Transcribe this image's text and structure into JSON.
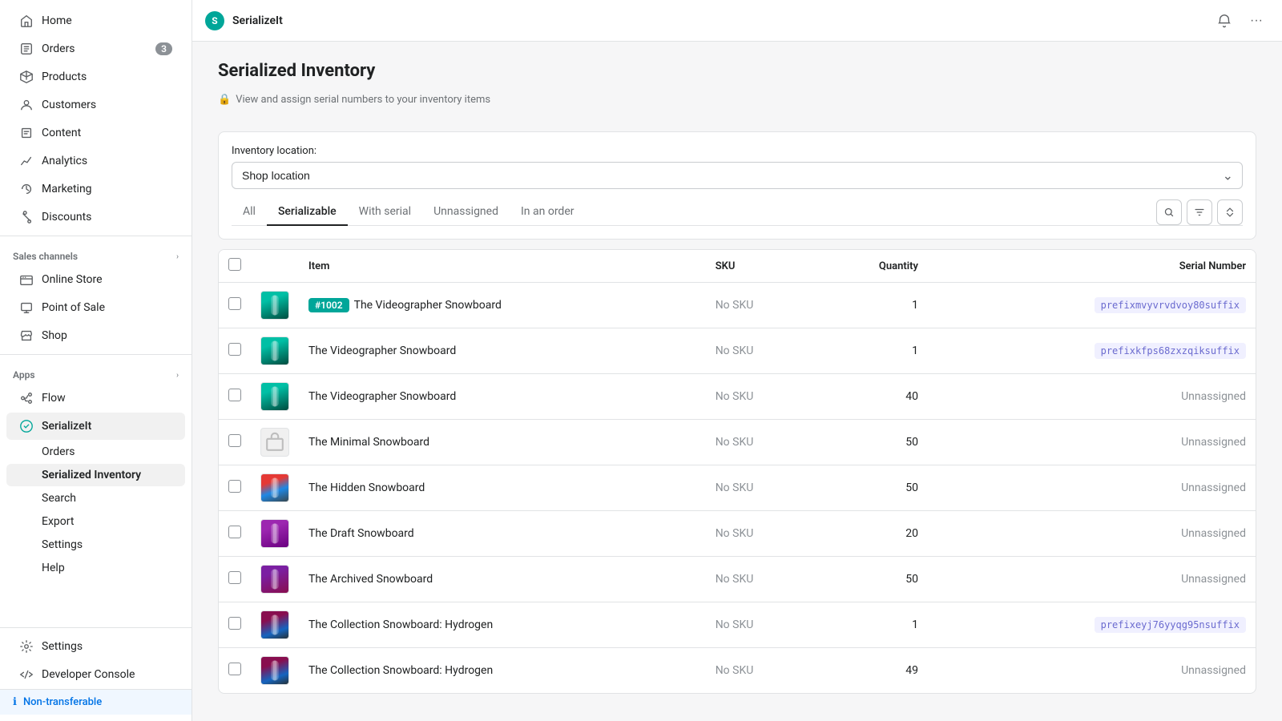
{
  "topbar": {
    "logo_text": "S",
    "title": "SerializeIt",
    "logo_bg": "#00a699"
  },
  "sidebar": {
    "nav_items": [
      {
        "id": "home",
        "label": "Home",
        "icon": "home"
      },
      {
        "id": "orders",
        "label": "Orders",
        "icon": "orders",
        "badge": "3"
      },
      {
        "id": "products",
        "label": "Products",
        "icon": "products"
      },
      {
        "id": "customers",
        "label": "Customers",
        "icon": "customers"
      },
      {
        "id": "content",
        "label": "Content",
        "icon": "content"
      },
      {
        "id": "analytics",
        "label": "Analytics",
        "icon": "analytics"
      },
      {
        "id": "marketing",
        "label": "Marketing",
        "icon": "marketing"
      },
      {
        "id": "discounts",
        "label": "Discounts",
        "icon": "discounts"
      }
    ],
    "sales_channels": {
      "label": "Sales channels",
      "items": [
        {
          "id": "online-store",
          "label": "Online Store"
        },
        {
          "id": "point-of-sale",
          "label": "Point of Sale"
        },
        {
          "id": "shop",
          "label": "Shop"
        }
      ]
    },
    "apps": {
      "label": "Apps",
      "items": [
        {
          "id": "flow",
          "label": "Flow"
        },
        {
          "id": "serializeit",
          "label": "SerializeIt",
          "active": true,
          "sub_items": [
            {
              "id": "orders",
              "label": "Orders"
            },
            {
              "id": "serialized-inventory",
              "label": "Serialized Inventory",
              "active": true
            },
            {
              "id": "search",
              "label": "Search"
            },
            {
              "id": "export",
              "label": "Export"
            },
            {
              "id": "settings",
              "label": "Settings"
            },
            {
              "id": "help",
              "label": "Help"
            }
          ]
        }
      ]
    },
    "bottom_items": [
      {
        "id": "settings",
        "label": "Settings",
        "icon": "gear"
      },
      {
        "id": "developer-console",
        "label": "Developer Console",
        "icon": "developer"
      }
    ]
  },
  "page": {
    "title": "Serialized Inventory",
    "subtitle": "View and assign serial numbers to your inventory items",
    "inventory_location_label": "Inventory location:",
    "location_value": "Shop location",
    "tabs": [
      {
        "id": "all",
        "label": "All"
      },
      {
        "id": "serializable",
        "label": "Serializable",
        "active": true
      },
      {
        "id": "with-serial",
        "label": "With serial"
      },
      {
        "id": "unnassigned",
        "label": "Unnassigned"
      },
      {
        "id": "in-an-order",
        "label": "In an order"
      }
    ],
    "table": {
      "columns": [
        {
          "id": "item",
          "label": "Item"
        },
        {
          "id": "sku",
          "label": "SKU"
        },
        {
          "id": "quantity",
          "label": "Quantity",
          "align": "right"
        },
        {
          "id": "serial",
          "label": "Serial Number",
          "align": "right"
        }
      ],
      "rows": [
        {
          "id": "row1",
          "badge": "#1002",
          "item": "The Videographer Snowboard",
          "sku": "No SKU",
          "quantity": "1",
          "serial": "prefixmvyvrvdvoy80suffix",
          "serial_type": "badge",
          "img_type": "teal"
        },
        {
          "id": "row2",
          "item": "The Videographer Snowboard",
          "sku": "No SKU",
          "quantity": "1",
          "serial": "prefixkfps68zxzqiksuffix",
          "serial_type": "badge",
          "img_type": "teal"
        },
        {
          "id": "row3",
          "item": "The Videographer Snowboard",
          "sku": "No SKU",
          "quantity": "40",
          "serial": "Unnassigned",
          "serial_type": "plain",
          "img_type": "teal"
        },
        {
          "id": "row4",
          "item": "The Minimal Snowboard",
          "sku": "No SKU",
          "quantity": "50",
          "serial": "Unnassigned",
          "serial_type": "plain",
          "img_type": "box"
        },
        {
          "id": "row5",
          "item": "The Hidden Snowboard",
          "sku": "No SKU",
          "quantity": "50",
          "serial": "Unnassigned",
          "serial_type": "plain",
          "img_type": "mixed"
        },
        {
          "id": "row6",
          "item": "The Draft Snowboard",
          "sku": "No SKU",
          "quantity": "20",
          "serial": "Unnassigned",
          "serial_type": "plain",
          "img_type": "purple"
        },
        {
          "id": "row7",
          "item": "The Archived Snowboard",
          "sku": "No SKU",
          "quantity": "50",
          "serial": "Unnassigned",
          "serial_type": "plain",
          "img_type": "darkred"
        },
        {
          "id": "row8",
          "item": "The Collection Snowboard: Hydrogen",
          "sku": "No SKU",
          "quantity": "1",
          "serial": "prefixeyj76yyqg95nsuffix",
          "serial_type": "badge",
          "img_type": "mixed2"
        },
        {
          "id": "row9",
          "item": "The Collection Snowboard: Hydrogen",
          "sku": "No SKU",
          "quantity": "49",
          "serial": "Unnassigned",
          "serial_type": "plain",
          "img_type": "mixed2"
        }
      ]
    }
  },
  "non_transferable": {
    "label": "Non-transferable"
  }
}
